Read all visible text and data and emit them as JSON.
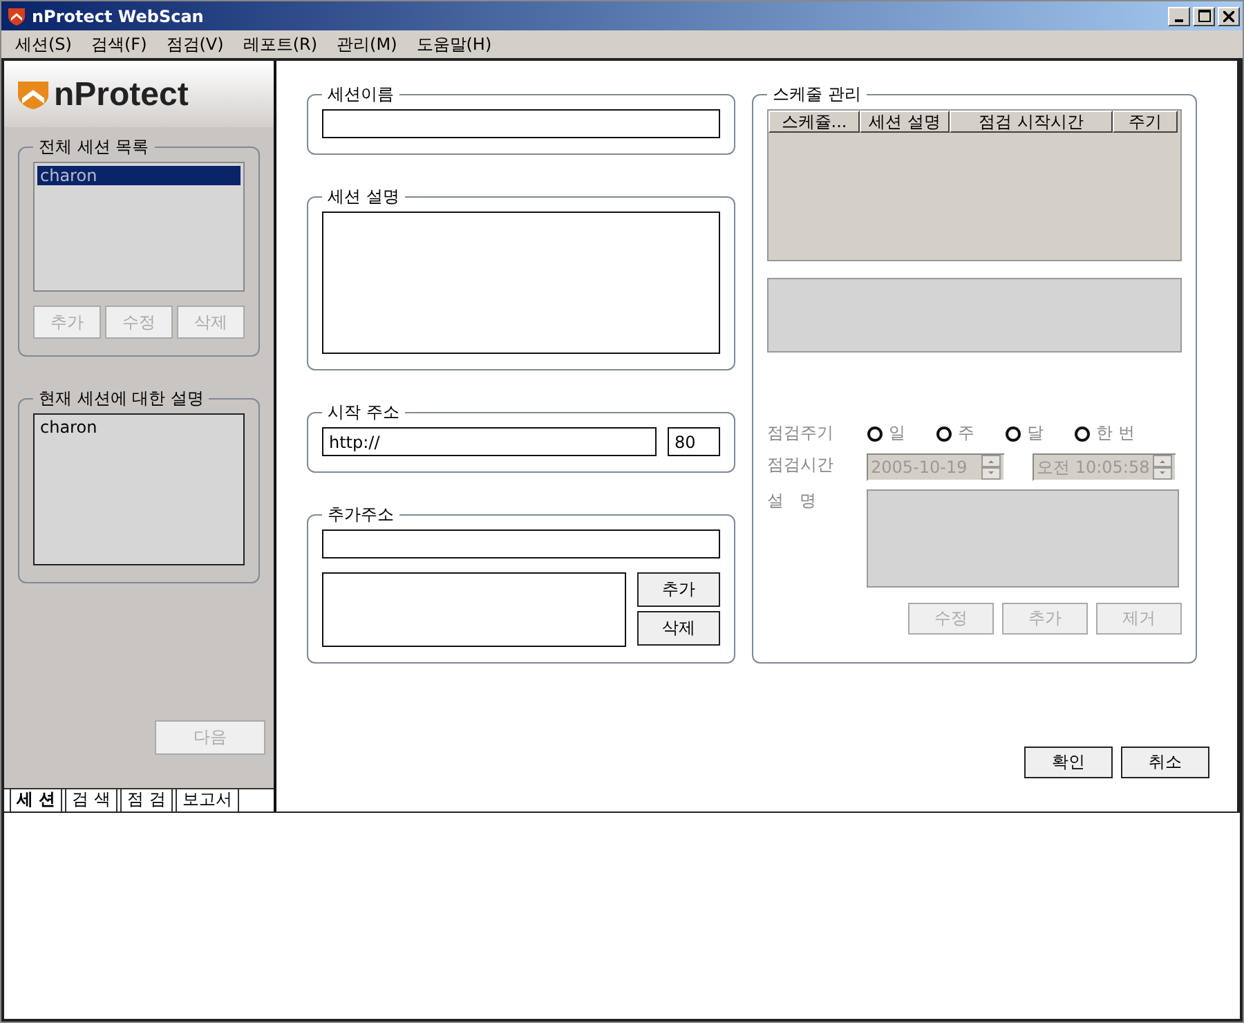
{
  "window": {
    "title": "nProtect WebScan"
  },
  "menu": [
    "세션(S)",
    "검색(F)",
    "점검(V)",
    "레포트(R)",
    "관리(M)",
    "도움말(H)"
  ],
  "sidebar": {
    "logo": "nProtect",
    "session_list": {
      "title": "전체 세션 목록",
      "items": [
        {
          "label": "charon",
          "selected": true
        }
      ],
      "buttons": [
        {
          "label": "추가",
          "disabled": true
        },
        {
          "label": "수정",
          "disabled": true
        },
        {
          "label": "삭제",
          "disabled": true
        }
      ]
    },
    "current_session": {
      "title": "현재 세션에 대한 설명",
      "text": "charon"
    },
    "next_button": {
      "label": "다음",
      "disabled": true
    },
    "tabs": [
      {
        "label": "세 션",
        "selected": true
      },
      {
        "label": "검 색",
        "selected": false
      },
      {
        "label": "점 검",
        "selected": false
      },
      {
        "label": "보고서",
        "selected": false
      }
    ]
  },
  "session_name": {
    "title": "세션이름"
  },
  "session_description": {
    "title": "세션 설명"
  },
  "start_address": {
    "title": "시작 주소",
    "url": "http://",
    "port": "80"
  },
  "extra_address": {
    "title": "추가주소",
    "buttons": [
      {
        "label": "추가"
      },
      {
        "label": "삭제"
      }
    ]
  },
  "schedule": {
    "title": "스케줄 관리",
    "columns": [
      "스케쥴...",
      "세션 설명",
      "점검 시작시간",
      "주기"
    ],
    "period_label": "점검주기",
    "periods": [
      {
        "label": "일",
        "selected": false
      },
      {
        "label": "주",
        "selected": false
      },
      {
        "label": "달",
        "selected": false
      },
      {
        "label": "한 번",
        "selected": false
      }
    ],
    "time_label": "점검시간",
    "date": "2005-10-19",
    "time": "오전 10:05:58",
    "fields_disabled": true,
    "description_label": "설   명",
    "buttons": [
      {
        "label": "수정",
        "disabled": true
      },
      {
        "label": "추가",
        "disabled": true
      },
      {
        "label": "제거",
        "disabled": true
      }
    ]
  },
  "dialog_buttons": [
    {
      "label": "확인"
    },
    {
      "label": "취소"
    }
  ]
}
